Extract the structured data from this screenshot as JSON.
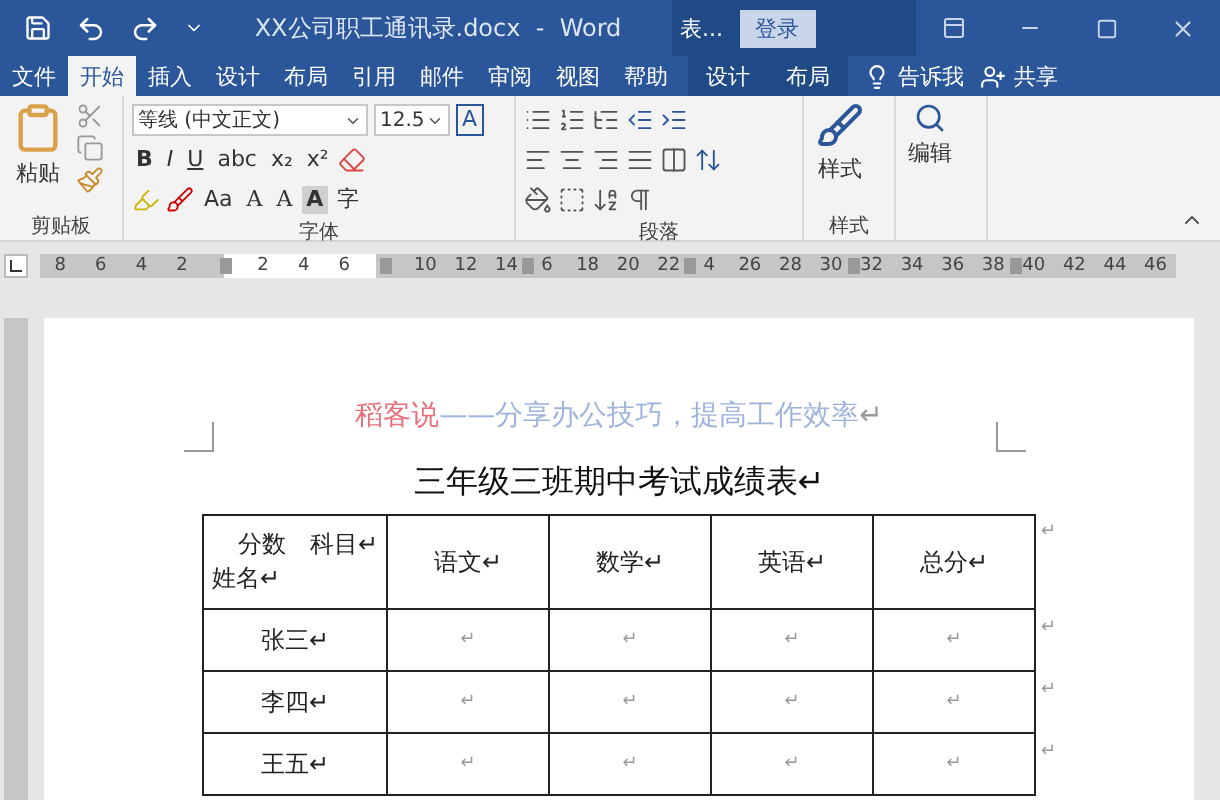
{
  "title_bar": {
    "title": "XX公司职工通讯录.docx  -  Word",
    "context_label": "表...",
    "login_button": "登录"
  },
  "tabs": [
    {
      "label": "文件",
      "selected": false,
      "kind": "normal"
    },
    {
      "label": "开始",
      "selected": true,
      "kind": "normal"
    },
    {
      "label": "插入",
      "selected": false,
      "kind": "normal"
    },
    {
      "label": "设计",
      "selected": false,
      "kind": "normal"
    },
    {
      "label": "布局",
      "selected": false,
      "kind": "normal"
    },
    {
      "label": "引用",
      "selected": false,
      "kind": "normal"
    },
    {
      "label": "邮件",
      "selected": false,
      "kind": "normal"
    },
    {
      "label": "审阅",
      "selected": false,
      "kind": "normal"
    },
    {
      "label": "视图",
      "selected": false,
      "kind": "normal"
    },
    {
      "label": "帮助",
      "selected": false,
      "kind": "normal"
    },
    {
      "label": "设计",
      "selected": false,
      "kind": "contextual"
    },
    {
      "label": "布局",
      "selected": false,
      "kind": "contextual"
    }
  ],
  "tell_me": "告诉我",
  "share": "共享",
  "ribbon": {
    "clipboard": {
      "paste": "粘贴",
      "label": "剪贴板"
    },
    "font": {
      "font_name": "等线 (中文正文)",
      "font_size": "12.5",
      "char_border": "A",
      "format_buttons": [
        "B",
        "I",
        "U",
        "abc",
        "x₂",
        "x²"
      ],
      "case_button": "Aa",
      "grow_buttons": [
        "A",
        "A"
      ],
      "shading_button": "A",
      "enclose_button": "字",
      "label": "字体"
    },
    "paragraph": {
      "label": "段落"
    },
    "styles": {
      "button": "样式",
      "label": "样式"
    },
    "editing": {
      "button": "编辑"
    }
  },
  "ruler": {
    "segments": [
      [
        "8",
        "6",
        "4",
        "2"
      ],
      [
        "2",
        "4",
        "6"
      ],
      [
        "10",
        "12",
        "14",
        "6",
        "18",
        "20",
        "22",
        "4",
        "26",
        "28",
        "30",
        "32",
        "34",
        "36",
        "38",
        "40",
        "42",
        "44",
        "46"
      ]
    ]
  },
  "document": {
    "header_parts": [
      {
        "text": "稻客说",
        "color": "#e8707a"
      },
      {
        "text": "——分享办公技巧，提高工作效率",
        "color": "#9db3de"
      },
      {
        "text": "↵",
        "color": "#9a9a9a"
      }
    ],
    "title": "三年级三班期中考试成绩表↵",
    "table": {
      "corner_top": "分数　科目↵",
      "corner_bottom": "姓名↵",
      "columns": [
        "语文↵",
        "数学↵",
        "英语↵",
        "总分↵"
      ],
      "rows": [
        {
          "name": "张三↵",
          "cells": [
            "↵",
            "↵",
            "↵",
            "↵"
          ],
          "end_mark": "↵"
        },
        {
          "name": "李四↵",
          "cells": [
            "↵",
            "↵",
            "↵",
            "↵"
          ],
          "end_mark": "↵"
        },
        {
          "name": "王五↵",
          "cells": [
            "↵",
            "↵",
            "↵",
            "↵"
          ],
          "end_mark": "↵"
        }
      ],
      "header_end_mark": "↵"
    }
  }
}
